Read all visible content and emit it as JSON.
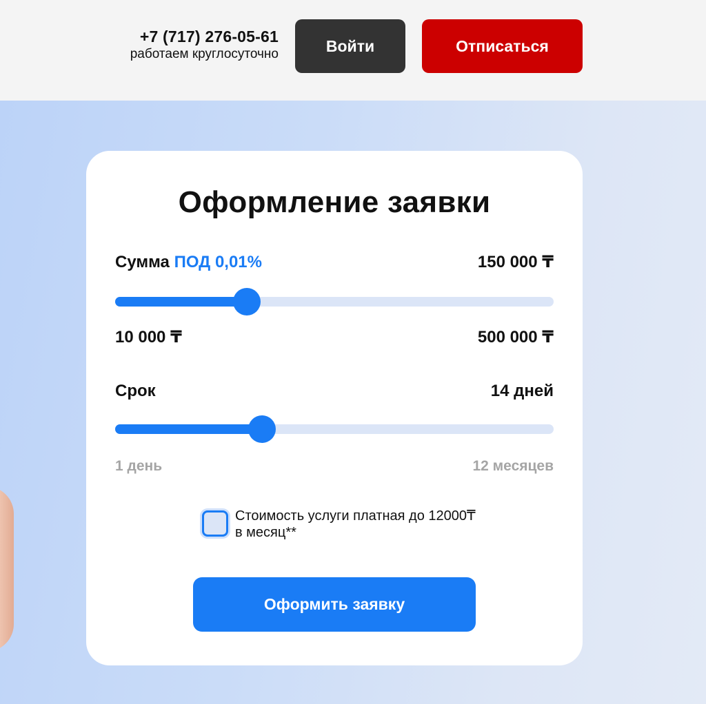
{
  "header": {
    "phone": "+7 (717) 276-05-61",
    "hours": "работаем круглосуточно",
    "login_label": "Войти",
    "unsubscribe_label": "Отписаться"
  },
  "colors": {
    "accent": "#1a7cf5",
    "login_button": "#333333",
    "unsubscribe_button": "#cc0000",
    "card": "#ffffff"
  },
  "form": {
    "title": "Оформление заявки",
    "amount": {
      "label": "Сумма",
      "rate_label": "ПОД 0,01%",
      "value": "150 000 ₸",
      "min_label": "10 000 ₸",
      "max_label": "500 000 ₸",
      "level": 0.3
    },
    "term": {
      "label": "Срок",
      "value": "14 дней",
      "min_label": "1 день",
      "max_label": "12 месяцев",
      "level": 0.335
    },
    "consent_text": "Стоимость услуги платная до 12000₸ в месяц**",
    "submit_label": "Оформить заявку"
  }
}
